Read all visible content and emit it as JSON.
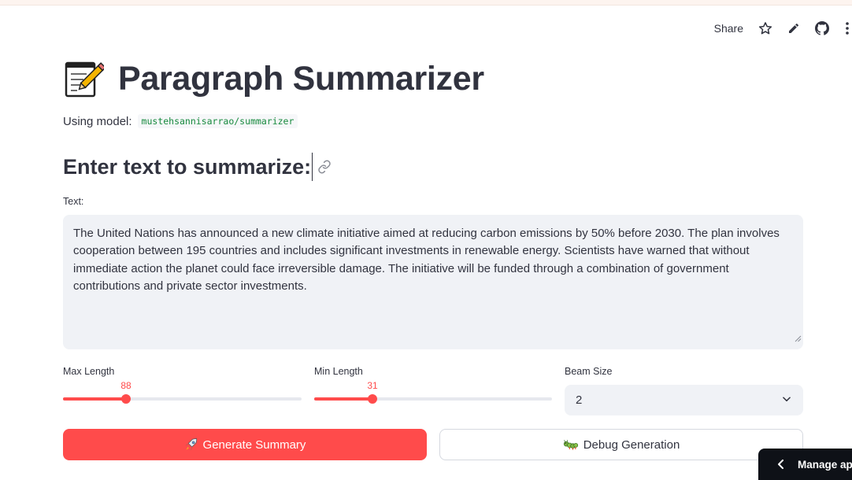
{
  "toolbar": {
    "share_label": "Share",
    "icons": [
      "star-icon",
      "pencil-icon",
      "github-icon",
      "more-vertical-icon"
    ]
  },
  "header": {
    "emoji": "memo-icon",
    "title": "Paragraph Summarizer"
  },
  "model_info": {
    "label": "Using model:",
    "model_name": "mustehsannisarrao/summarizer"
  },
  "section": {
    "heading": "Enter text to summarize:"
  },
  "text_input": {
    "label": "Text:",
    "value": "The United Nations has announced a new climate initiative aimed at reducing carbon emissions by 50% before 2030. The plan involves cooperation between 195 countries and includes significant investments in renewable energy. Scientists have warned that without immediate action the planet could face irreversible damage. The initiative will be funded through a combination of government contributions and private sector investments."
  },
  "controls": {
    "max_length": {
      "label": "Max Length",
      "value": "88"
    },
    "min_length": {
      "label": "Min Length",
      "value": "31"
    },
    "beam_size": {
      "label": "Beam Size",
      "value": "2"
    }
  },
  "buttons": {
    "generate_label": "Generate Summary",
    "generate_icon": "rocket-icon",
    "debug_label": "Debug Generation",
    "debug_icon": "bug-icon"
  },
  "manage_app": {
    "label": "Manage app"
  },
  "colors": {
    "accent": "#ff4b4b",
    "text": "#31333f",
    "input_bg": "#f0f2f6",
    "code_green": "#178a3e",
    "dark_panel": "#0e1117"
  }
}
